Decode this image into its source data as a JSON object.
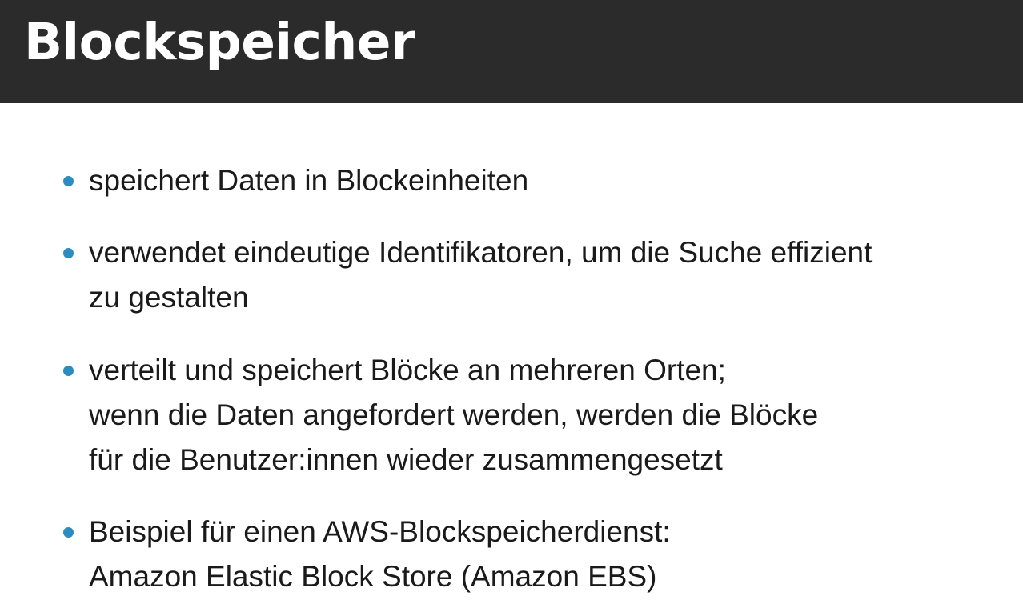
{
  "slide": {
    "title": "Blockspeicher",
    "accent_color": "#2b8cc2",
    "header_color": "#2b2b2b",
    "bullets": [
      {
        "lines": [
          "speichert Daten in Blockeinheiten"
        ]
      },
      {
        "lines": [
          "verwendet eindeutige Identifikatoren, um die Suche effizient",
          "zu gestalten"
        ]
      },
      {
        "lines": [
          "verteilt und speichert Blöcke an mehreren Orten;",
          "wenn die Daten angefordert werden, werden die Blöcke",
          "für die Benutzer:innen wieder zusammengesetzt"
        ]
      },
      {
        "lines": [
          "Beispiel für einen AWS-Blockspeicherdienst:",
          "Amazon Elastic Block Store (Amazon EBS)"
        ]
      }
    ]
  }
}
